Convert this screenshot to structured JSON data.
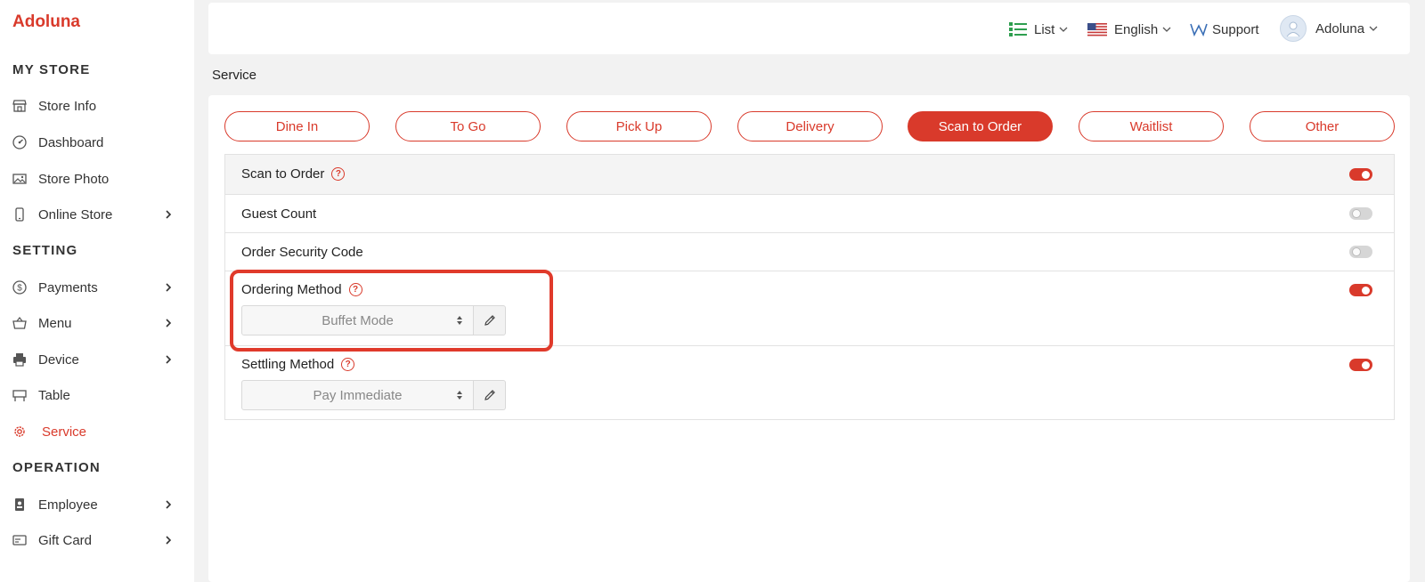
{
  "sidebar": {
    "brand": "Adoluna",
    "sections": {
      "my_store": "MY STORE",
      "setting": "SETTING",
      "operation": "OPERATION"
    },
    "items": {
      "store_info": "Store Info",
      "dashboard": "Dashboard",
      "store_photo": "Store Photo",
      "online_store": "Online Store",
      "payments": "Payments",
      "menu": "Menu",
      "device": "Device",
      "table": "Table",
      "service": "Service",
      "employee": "Employee",
      "gift_card": "Gift Card"
    },
    "active_item": "service"
  },
  "topbar": {
    "list": "List",
    "language": "English",
    "support": "Support",
    "user": "Adoluna"
  },
  "page": {
    "title": "Service"
  },
  "tabs": [
    {
      "label": "Dine In",
      "active": false
    },
    {
      "label": "To Go",
      "active": false
    },
    {
      "label": "Pick Up",
      "active": false
    },
    {
      "label": "Delivery",
      "active": false
    },
    {
      "label": "Scan to Order",
      "active": true
    },
    {
      "label": "Waitlist",
      "active": false
    },
    {
      "label": "Other",
      "active": false
    }
  ],
  "settings": {
    "scan_to_order": {
      "label": "Scan to Order",
      "enabled": true
    },
    "guest_count": {
      "label": "Guest Count",
      "enabled": false
    },
    "order_security_code": {
      "label": "Order Security Code",
      "enabled": false
    },
    "ordering_method": {
      "label": "Ordering Method",
      "enabled": true,
      "value": "Buffet Mode"
    },
    "settling_method": {
      "label": "Settling Method",
      "enabled": true,
      "value": "Pay Immediate"
    }
  },
  "colors": {
    "accent": "#d93a2b",
    "highlight": "#e03a2b"
  }
}
